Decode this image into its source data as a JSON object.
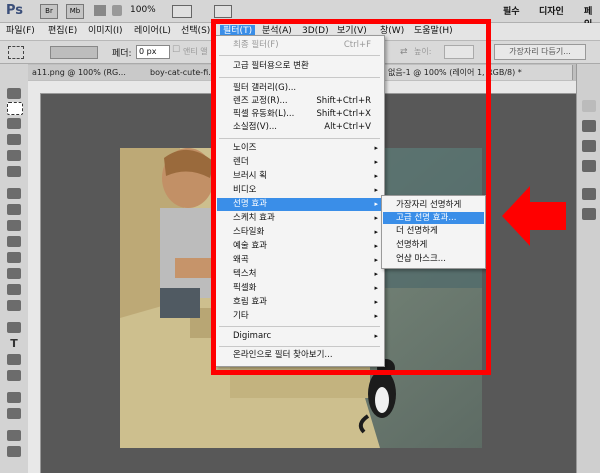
{
  "app": {
    "logo": "Ps",
    "icon_br": "Br",
    "icon_mb": "Mb",
    "zoom": "100%",
    "workspace_essentials": "필수",
    "workspace_design": "디자인",
    "workspace_paint": "페인"
  },
  "menubar": [
    "파일(F)",
    "편집(E)",
    "이미지(I)",
    "레이어(L)",
    "선택(S)",
    "필터(T)",
    "분석(A)",
    "3D(D)",
    "보기(V)",
    "창(W)",
    "도움말(H)"
  ],
  "options": {
    "feather_label": "페더:",
    "feather_value": "0 px",
    "antialias_label": "앤티 앨",
    "height_label": "높이:",
    "refine_edge": "가장자리 다듬기..."
  },
  "tabs": [
    "a11.png @ 100% (RG...",
    "boy-cat-cute-fi...",
    "없음-1 @ 100% (레이어 1, RGB/8) *"
  ],
  "filter_menu": {
    "items": [
      {
        "label": "최종 필터(F)",
        "shortcut": "Ctrl+F",
        "disabled": true
      },
      {
        "label": "고급 필터용으로 변환"
      },
      {
        "label": "필터 갤러리(G)..."
      },
      {
        "label": "렌즈 교정(R)...",
        "shortcut": "Shift+Ctrl+R"
      },
      {
        "label": "픽셀 유동화(L)...",
        "shortcut": "Shift+Ctrl+X"
      },
      {
        "label": "소실점(V)...",
        "shortcut": "Alt+Ctrl+V"
      },
      {
        "label": "노이즈"
      },
      {
        "label": "렌더"
      },
      {
        "label": "브러시 획"
      },
      {
        "label": "비디오"
      },
      {
        "label": "선명 효과",
        "highlighted": true
      },
      {
        "label": "스케치 효과"
      },
      {
        "label": "스타일화"
      },
      {
        "label": "예술 효과"
      },
      {
        "label": "왜곡"
      },
      {
        "label": "텍스처"
      },
      {
        "label": "픽셀화"
      },
      {
        "label": "흐림 효과"
      },
      {
        "label": "기타"
      },
      {
        "label": "Digimarc"
      },
      {
        "label": "온라인으로 필터 찾아보기..."
      }
    ]
  },
  "sharpen_submenu": {
    "items": [
      {
        "label": "가장자리 선명하게"
      },
      {
        "label": "고급 선명 효과...",
        "highlighted": true
      },
      {
        "label": "더 선명하게"
      },
      {
        "label": "선명하게"
      },
      {
        "label": "언샵 마스크..."
      }
    ]
  },
  "colors": {
    "highlight": "#3a8ee8",
    "annotation_red": "#ff0000"
  },
  "icons": {
    "submenu_arrow": "▸",
    "checkbox": "☐"
  }
}
